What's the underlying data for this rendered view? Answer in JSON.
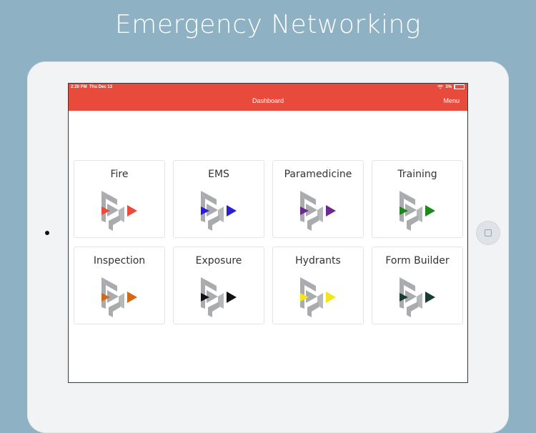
{
  "headline": "Emergency Networking",
  "status_bar": {
    "time": "2:20 PM",
    "date": "Thu Dec 13",
    "battery": "3%",
    "battery_fraction": 0.03
  },
  "nav": {
    "title": "Dashboard",
    "menu_label": "Menu"
  },
  "tiles": [
    {
      "label": "Fire",
      "color": "#e84b3c"
    },
    {
      "label": "EMS",
      "color": "#2b1fd6"
    },
    {
      "label": "Paramedicine",
      "color": "#6b2a8c"
    },
    {
      "label": "Training",
      "color": "#1a8a1a"
    },
    {
      "label": "Inspection",
      "color": "#d06a18"
    },
    {
      "label": "Exposure",
      "color": "#111111"
    },
    {
      "label": "Hydrants",
      "color": "#f2e51a"
    },
    {
      "label": "Form Builder",
      "color": "#173d2e"
    }
  ],
  "colors": {
    "accent": "#e84b3c",
    "logo_gray": "#a9abae",
    "background": "#8fb1c4"
  },
  "icons": {
    "wifi": "wifi-icon",
    "battery": "battery-icon",
    "tile_logo": "emergency-networking-logo-icon"
  }
}
